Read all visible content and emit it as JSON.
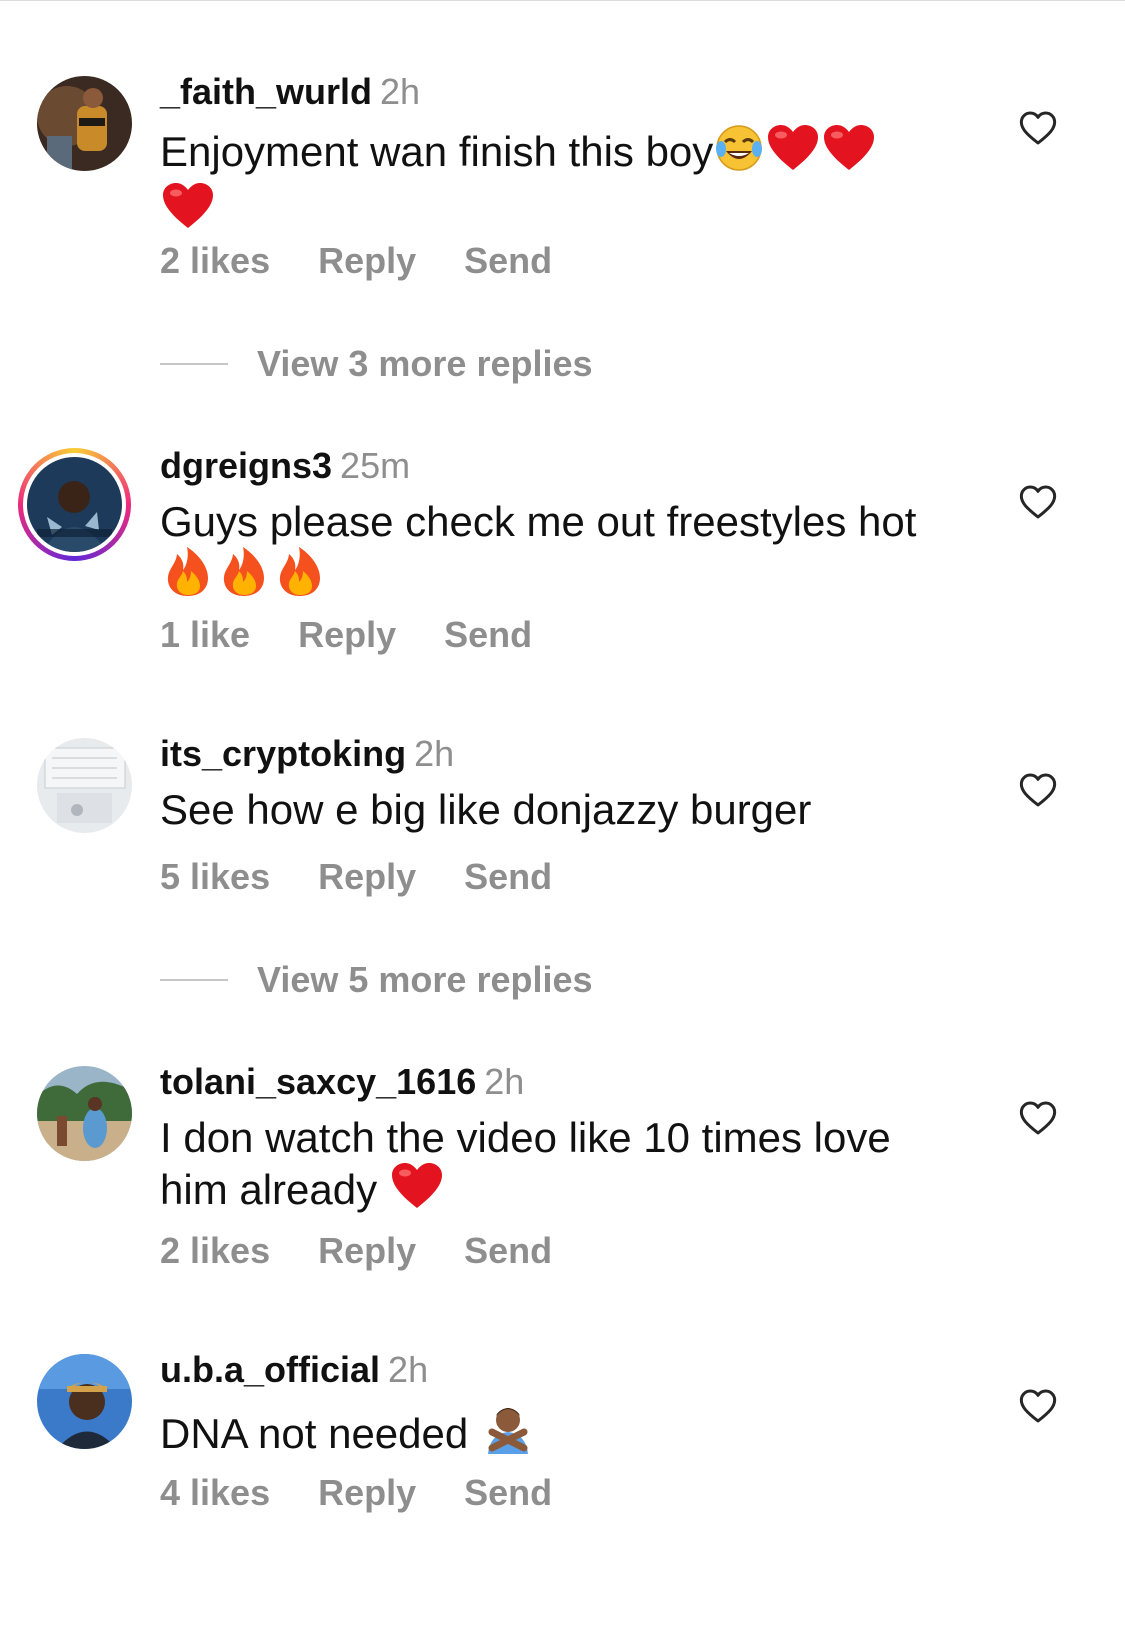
{
  "colors": {
    "username": "#111111",
    "secondary": "#8e8e8e",
    "story_ring_start": "#f9ce34",
    "story_ring_mid": "#ee2a7b",
    "story_ring_end": "#6228d7"
  },
  "comments": [
    {
      "username": "_faith_wurld",
      "time": "2h",
      "text": "Enjoyment wan finish this boy",
      "emojis": [
        "face-with-tears-of-joy",
        "red-heart",
        "red-heart",
        "red-heart"
      ],
      "likes": "2 likes",
      "reply": "Reply",
      "send": "Send",
      "has_story": false,
      "view_replies": "View 3 more replies"
    },
    {
      "username": "dgreigns3",
      "time": "25m",
      "text": "Guys please check me out freestyles hot",
      "emojis": [
        "fire",
        "fire",
        "fire"
      ],
      "likes": "1 like",
      "reply": "Reply",
      "send": "Send",
      "has_story": true,
      "view_replies": null
    },
    {
      "username": "its_cryptoking",
      "time": "2h",
      "text": "See how e big like donjazzy burger",
      "emojis": [],
      "likes": "5 likes",
      "reply": "Reply",
      "send": "Send",
      "has_story": false,
      "view_replies": "View 5 more replies"
    },
    {
      "username": "tolani_saxcy_1616",
      "time": "2h",
      "text": "I don watch the video like 10 times love him already",
      "emojis": [
        "red-heart"
      ],
      "likes": "2 likes",
      "reply": "Reply",
      "send": "Send",
      "has_story": false,
      "view_replies": null
    },
    {
      "username": "u.b.a_official",
      "time": "2h",
      "text": "DNA not needed",
      "emojis": [
        "person-gesturing-no"
      ],
      "likes": "4 likes",
      "reply": "Reply",
      "send": "Send",
      "has_story": false,
      "view_replies": null
    }
  ]
}
